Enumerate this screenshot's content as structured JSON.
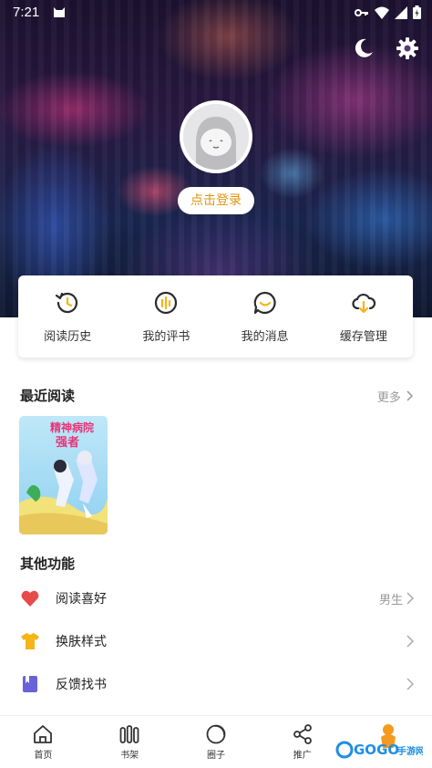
{
  "status_bar": {
    "time": "7:21"
  },
  "header": {
    "login_label": "点击登录"
  },
  "quick_actions": [
    {
      "label": "阅读历史",
      "icon": "history-icon"
    },
    {
      "label": "我的评书",
      "icon": "comment-chart-icon"
    },
    {
      "label": "我的消息",
      "icon": "message-smile-icon"
    },
    {
      "label": "缓存管理",
      "icon": "cloud-download-icon"
    }
  ],
  "recent": {
    "title": "最近阅读",
    "more_label": "更多",
    "book": {
      "cover_title": "精神病院最强者"
    }
  },
  "other": {
    "title": "其他功能",
    "items": [
      {
        "label": "阅读喜好",
        "value": "男生",
        "icon": "heart-icon"
      },
      {
        "label": "换肤样式",
        "value": "",
        "icon": "shirt-icon"
      },
      {
        "label": "反馈找书",
        "value": "",
        "icon": "book-icon"
      }
    ]
  },
  "bottom_nav": [
    {
      "label": "首页",
      "icon": "home-icon"
    },
    {
      "label": "书架",
      "icon": "bookshelf-icon"
    },
    {
      "label": "圈子",
      "icon": "circle-icon"
    },
    {
      "label": "推广",
      "icon": "share-icon"
    }
  ],
  "watermark": {
    "text": "GOGO手游网"
  },
  "colors": {
    "accent": "#e0960e",
    "icon_dark": "#2b2b2b",
    "heart": "#e84a4a",
    "shirt": "#f5b417",
    "book": "#6a62d8"
  }
}
